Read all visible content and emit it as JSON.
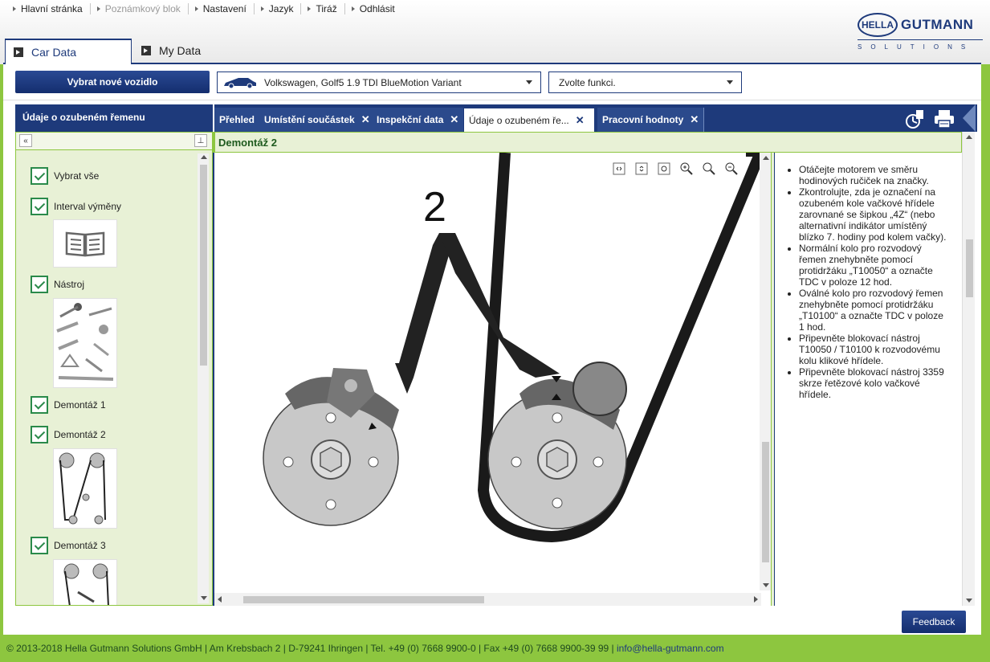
{
  "nav": [
    {
      "label": "Hlavní stránka",
      "disabled": false
    },
    {
      "label": "Poznámkový blok",
      "disabled": true
    },
    {
      "label": "Nastavení",
      "disabled": false
    },
    {
      "label": "Jazyk",
      "disabled": false
    },
    {
      "label": "Tiráž",
      "disabled": false
    },
    {
      "label": "Odhlásit",
      "disabled": false
    }
  ],
  "logo": {
    "hella": "HELLA",
    "gutmann": "GUTMANN",
    "solutions": "SOLUTIONS"
  },
  "main_tabs": {
    "car_data": "Car Data",
    "my_data": "My Data"
  },
  "vehicle": {
    "select_button": "Vybrat nové vozidlo",
    "selected_vehicle": "Volkswagen, Golf5 1.9 TDI BlueMotion Variant",
    "function_placeholder": "Zvolte funkci."
  },
  "left_panel": {
    "title": "Údaje o ozubeném řemenu",
    "items": [
      {
        "label": "Vybrat vše"
      },
      {
        "label": "Interval výměny"
      },
      {
        "label": "Nástroj"
      },
      {
        "label": "Demontáž 1"
      },
      {
        "label": "Demontáž 2"
      },
      {
        "label": "Demontáž 3"
      }
    ]
  },
  "doc_tabs": [
    {
      "label": "Přehled",
      "closable": false
    },
    {
      "label": "Umístění součástek",
      "closable": true
    },
    {
      "label": "Inspekční data",
      "closable": true
    },
    {
      "label": "Údaje o ozubeném ře...",
      "closable": true,
      "active": true
    },
    {
      "label": "Pracovní hodnoty",
      "closable": true
    }
  ],
  "section": {
    "title": "Demontáž 2"
  },
  "figure": {
    "label": "2"
  },
  "instructions": [
    "Otáčejte motorem ve směru hodinových ručiček na značky.",
    "Zkontrolujte, zda je označení na ozubeném kole vačkové hřídele zarovnané se šipkou „4Z“ (nebo alternativní indikátor umístěný blízko 7. hodiny pod kolem vačky).",
    "Normální kolo pro rozvodový řemen znehybněte pomocí protidržáku „T10050“ a označte TDC v poloze 12 hod.",
    "Oválné kolo pro rozvodový řemen znehybněte pomocí protidržáku „T10100“ a označte TDC v poloze 1 hod.",
    "Připevněte blokovací nástroj T10050 / T10100 k rozvodovému kolu klikové hřídele.",
    "Připevněte blokovací nástroj 3359 skrze řetězové kolo vačkové hřídele."
  ],
  "feedback": "Feedback",
  "footer": {
    "text": "© 2013-2018 Hella Gutmann Solutions GmbH | Am Krebsbach 2 | D-79241 Ihringen | Tel. +49 (0) 7668 9900-0 | Fax +49 (0) 7668 9900-39 99 | ",
    "email": "info@hella-gutmann.com"
  },
  "colors": {
    "brand_blue": "#1e3a7b",
    "brand_green": "#8dc63f"
  }
}
